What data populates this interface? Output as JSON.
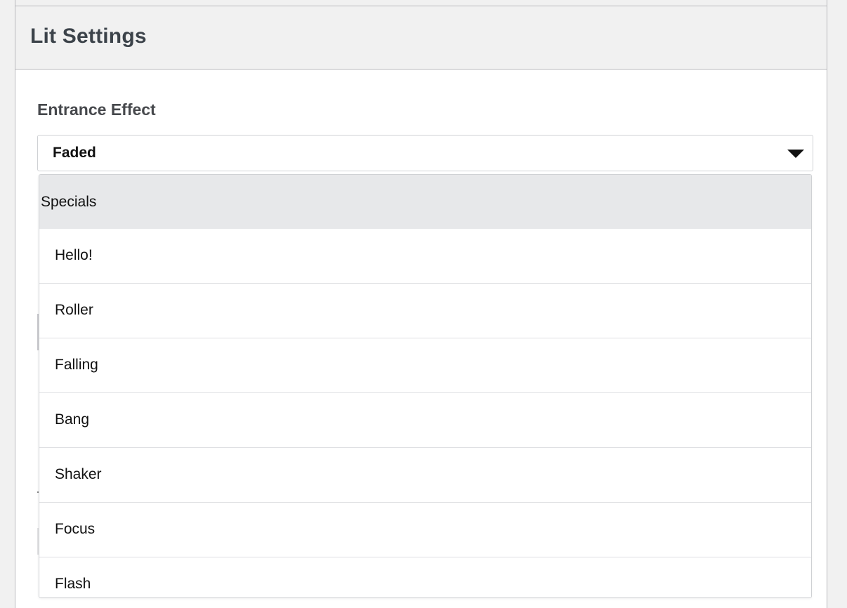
{
  "panel": {
    "title": "Lit Settings"
  },
  "entrance_effect": {
    "label": "Entrance Effect",
    "selected_value": "Faded",
    "dropdown": {
      "group_label": "Specials",
      "options": [
        "Hello!",
        "Roller",
        "Falling",
        "Bang",
        "Shaker",
        "Focus",
        "Flash"
      ]
    }
  }
}
